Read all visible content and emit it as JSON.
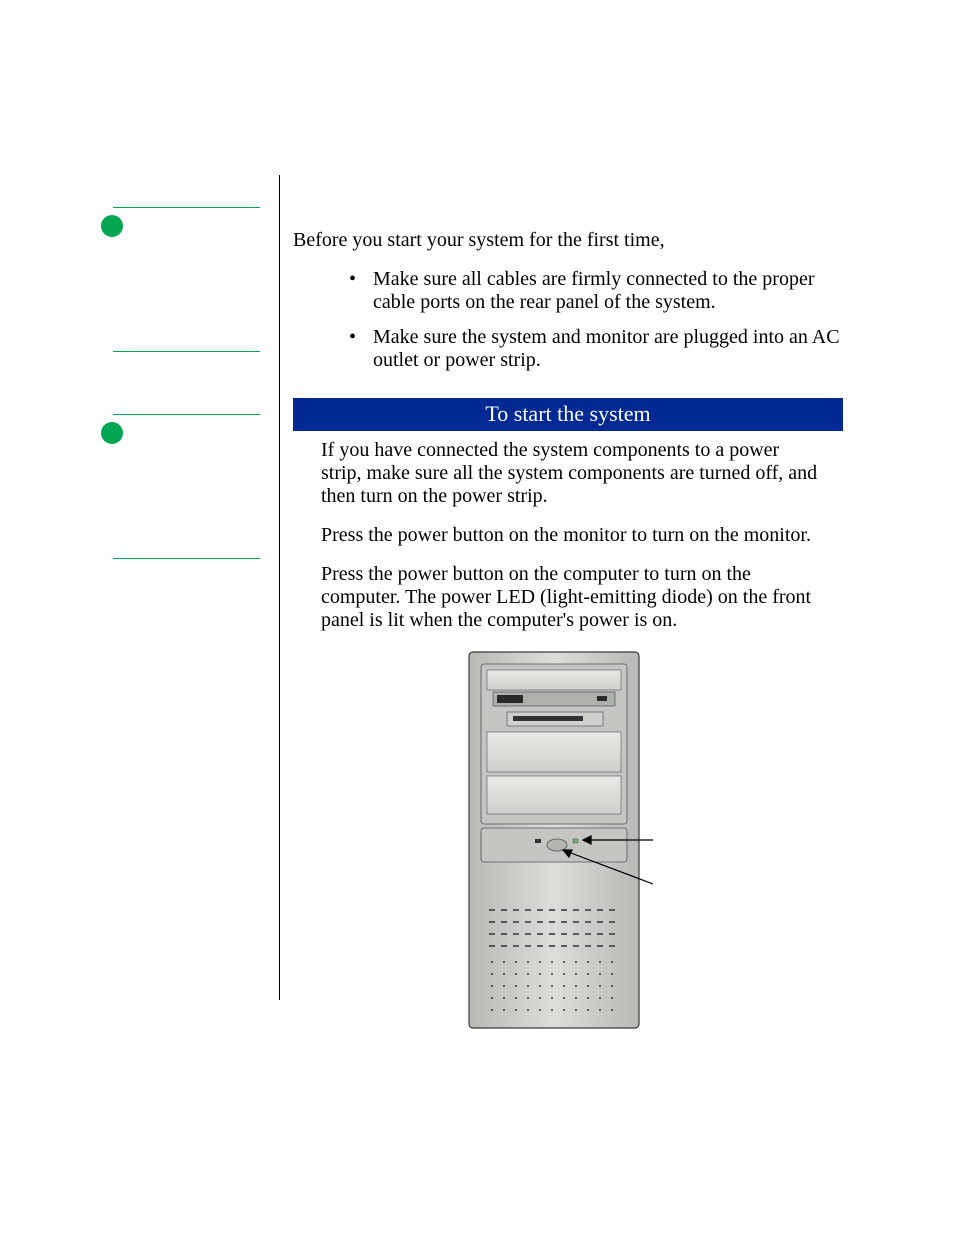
{
  "intro": "Before you start your system for the first time,",
  "bullets": [
    "Make sure all cables are firmly connected to the proper cable ports on the rear panel of the system.",
    "Make sure the system and monitor are plugged into an AC outlet or power strip."
  ],
  "section": {
    "heading": "To start the system",
    "paragraphs": [
      "If you have connected the system components to a power strip, make sure all the system components are turned off, and then turn on the power strip.",
      "Press the power button on the monitor to turn on the monitor.",
      "Press the power button on the computer to turn on the computer. The power LED (light-emitting diode) on the front panel is lit when the computer's power is on."
    ]
  }
}
